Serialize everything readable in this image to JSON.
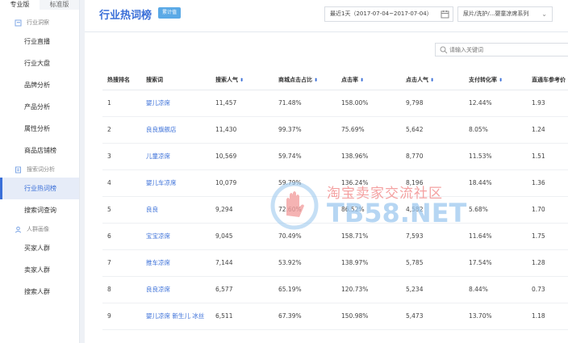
{
  "sidebar": {
    "tabs": [
      "专业版",
      "标准版"
    ],
    "sections": [
      {
        "label": "行业洞察",
        "items": [
          "行业直播",
          "行业大盘",
          "品牌分析",
          "产品分析",
          "属性分析",
          "商品店铺榜"
        ]
      },
      {
        "label": "搜索词分析",
        "items": [
          "行业热词榜",
          "搜索词查询"
        ]
      },
      {
        "label": "人群画像",
        "items": [
          "买家人群",
          "卖家人群",
          "搜索人群"
        ]
      }
    ]
  },
  "header": {
    "title": "行业热词榜",
    "badge": "累计值",
    "date_range": "最近1天（2017-07-04~2017-07-04）",
    "category": "尿片/洗护/...婴童凉席系列"
  },
  "search": {
    "placeholder": "请输入关键词"
  },
  "table": {
    "columns": [
      "热搜排名",
      "搜索词",
      "搜索人气",
      "商城点击占比",
      "点击率",
      "点击人气",
      "支付转化率",
      "直通车参考价"
    ],
    "sortable": [
      false,
      false,
      true,
      true,
      true,
      true,
      true,
      true
    ],
    "rows": [
      [
        "1",
        "婴儿凉席",
        "11,457",
        "71.48%",
        "158.00%",
        "9,798",
        "12.44%",
        "1.93"
      ],
      [
        "2",
        "良良旗舰店",
        "11,430",
        "99.37%",
        "75.69%",
        "5,642",
        "8.05%",
        "1.24"
      ],
      [
        "3",
        "儿童凉席",
        "10,569",
        "59.74%",
        "138.96%",
        "8,770",
        "11.53%",
        "1.51"
      ],
      [
        "4",
        "婴儿车凉席",
        "10,079",
        "59.79%",
        "136.24%",
        "8,196",
        "18.44%",
        "1.36"
      ],
      [
        "5",
        "良良",
        "9,294",
        "72.60%",
        "86.52%",
        "4,582",
        "5.68%",
        "1.70"
      ],
      [
        "6",
        "宝宝凉席",
        "9,045",
        "70.49%",
        "158.71%",
        "7,593",
        "11.64%",
        "1.75"
      ],
      [
        "7",
        "推车凉席",
        "7,144",
        "53.92%",
        "138.97%",
        "5,785",
        "17.54%",
        "1.28"
      ],
      [
        "8",
        "良良凉席",
        "6,577",
        "65.19%",
        "120.73%",
        "5,234",
        "8.44%",
        "0.73"
      ],
      [
        "9",
        "婴儿凉席 新生儿 冰丝",
        "6,511",
        "67.39%",
        "150.98%",
        "5,473",
        "13.70%",
        "1.18"
      ]
    ]
  },
  "watermark": {
    "line1": "淘宝卖家交流社区",
    "line2": "TB58.NET"
  },
  "colors": {
    "accent": "#3a6fd8",
    "badge": "#5aa9e6"
  }
}
